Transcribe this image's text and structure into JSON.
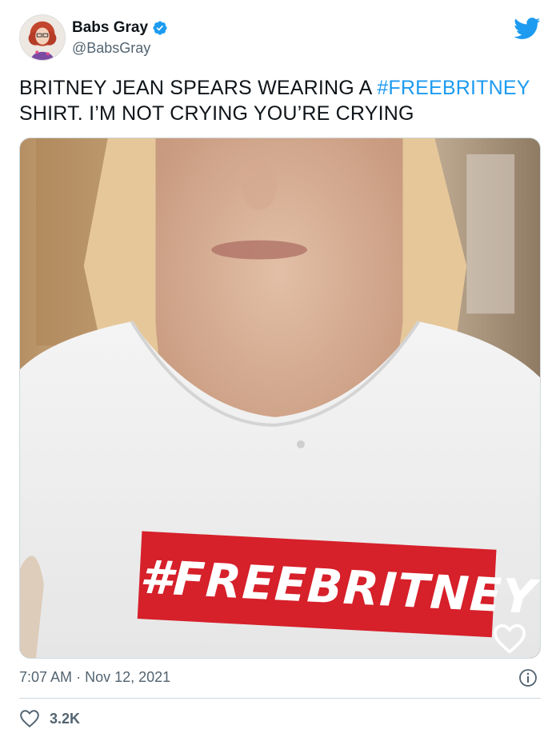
{
  "author": {
    "display_name": "Babs Gray",
    "handle": "@BabsGray",
    "verified": true
  },
  "tweet": {
    "text_part1": "BRITNEY JEAN SPEARS WEARING A ",
    "hashtag": "#FREEBRITNEY",
    "text_part2": " SHIRT. I’M NOT CRYING YOU’RE CRYING"
  },
  "media": {
    "shirt_text": "#FREEBRITNEY"
  },
  "meta": {
    "time": "7:07 AM",
    "separator": "·",
    "date": "Nov 12, 2021"
  },
  "engagement": {
    "likes": "3.2K"
  },
  "icons": {
    "brand": "twitter-bird-icon",
    "verified": "verified-badge-icon",
    "info": "info-icon",
    "like": "heart-icon"
  },
  "colors": {
    "accent": "#1d9bf0",
    "text": "#0f1419",
    "secondary": "#536471",
    "divider": "#cfd9de",
    "shirt_banner": "#d6202a"
  }
}
